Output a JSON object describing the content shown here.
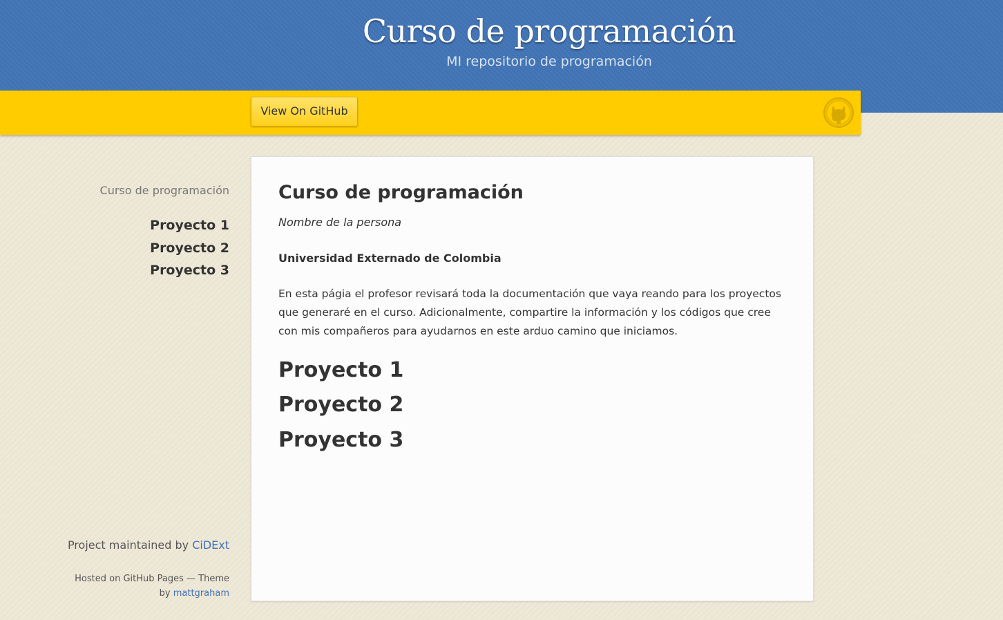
{
  "header": {
    "title": "Curso de programación",
    "subtitle": "MI repositorio de programación"
  },
  "nav": {
    "github_button": "View On GitHub",
    "icon": "github-octocat-icon"
  },
  "sidebar": {
    "heading": "Curso de programación",
    "items": [
      {
        "label": "Proyecto 1"
      },
      {
        "label": "Proyecto 2"
      },
      {
        "label": "Proyecto 3"
      }
    ],
    "maintained_prefix": "Project maintained by ",
    "maintainer": "CiDExt",
    "hosted_prefix": "Hosted on GitHub Pages — Theme by ",
    "theme_author": "mattgraham"
  },
  "main": {
    "title": "Curso de programación",
    "author": "Nombre de la persona",
    "university": "Universidad Externado de Colombia",
    "description": "En esta págia el profesor revisará toda la documentación que vaya reando para los proyectos que generaré en el curso. Adicionalmente, compartire la información y los códigos que cree con mis compañeros para ayudarnos en este arduo camino que iniciamos.",
    "sections": [
      {
        "label": "Proyecto 1"
      },
      {
        "label": "Proyecto 2"
      },
      {
        "label": "Proyecto 3"
      }
    ]
  },
  "colors": {
    "header_blue": "#4173b4",
    "nav_yellow": "#ffcc00",
    "background": "#ebe5d3",
    "link": "#4173b4"
  }
}
